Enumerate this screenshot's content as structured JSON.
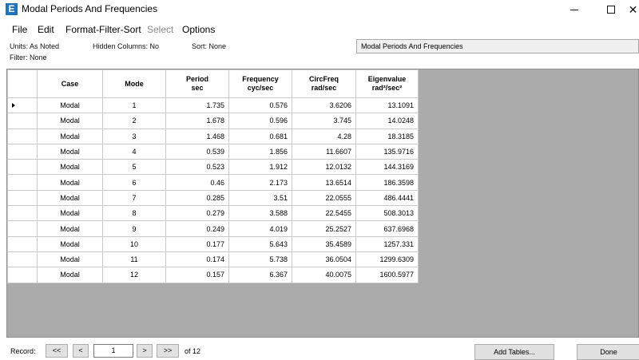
{
  "window": {
    "title": "Modal Periods And Frequencies",
    "app_icon_letter": "E"
  },
  "menu": [
    "File",
    "Edit",
    "Format-Filter-Sort",
    "Select",
    "Options"
  ],
  "info": {
    "units": "Units: As Noted",
    "hidden_columns": "Hidden Columns: No",
    "sort": "Sort: None",
    "filter": "Filter: None",
    "panel_title": "Modal Periods And Frequencies"
  },
  "table": {
    "headers": [
      [
        "Case",
        ""
      ],
      [
        "Mode",
        ""
      ],
      [
        "Period",
        "sec"
      ],
      [
        "Frequency",
        "cyc/sec"
      ],
      [
        "CircFreq",
        "rad/sec"
      ],
      [
        "Eigenvalue",
        "rad²/sec²"
      ]
    ],
    "rows": [
      [
        "Modal",
        "1",
        "1.735",
        "0.576",
        "3.6206",
        "13.1091"
      ],
      [
        "Modal",
        "2",
        "1.678",
        "0.596",
        "3.745",
        "14.0248"
      ],
      [
        "Modal",
        "3",
        "1.468",
        "0.681",
        "4.28",
        "18.3185"
      ],
      [
        "Modal",
        "4",
        "0.539",
        "1.856",
        "11.6607",
        "135.9716"
      ],
      [
        "Modal",
        "5",
        "0.523",
        "1.912",
        "12.0132",
        "144.3169"
      ],
      [
        "Modal",
        "6",
        "0.46",
        "2.173",
        "13.6514",
        "186.3598"
      ],
      [
        "Modal",
        "7",
        "0.285",
        "3.51",
        "22.0555",
        "486.4441"
      ],
      [
        "Modal",
        "8",
        "0.279",
        "3.588",
        "22.5455",
        "508.3013"
      ],
      [
        "Modal",
        "9",
        "0.249",
        "4.019",
        "25.2527",
        "637.6968"
      ],
      [
        "Modal",
        "10",
        "0.177",
        "5.643",
        "35.4589",
        "1257.331"
      ],
      [
        "Modal",
        "11",
        "0.174",
        "5.738",
        "36.0504",
        "1299.6309"
      ],
      [
        "Modal",
        "12",
        "0.157",
        "6.367",
        "40.0075",
        "1600.5977"
      ]
    ]
  },
  "nav": {
    "record_label": "Record:",
    "first": "<<",
    "prev": "<",
    "current": "1",
    "next": ">",
    "last": ">>",
    "of_label": "of 12",
    "add_tables": "Add Tables...",
    "done": "Done"
  }
}
